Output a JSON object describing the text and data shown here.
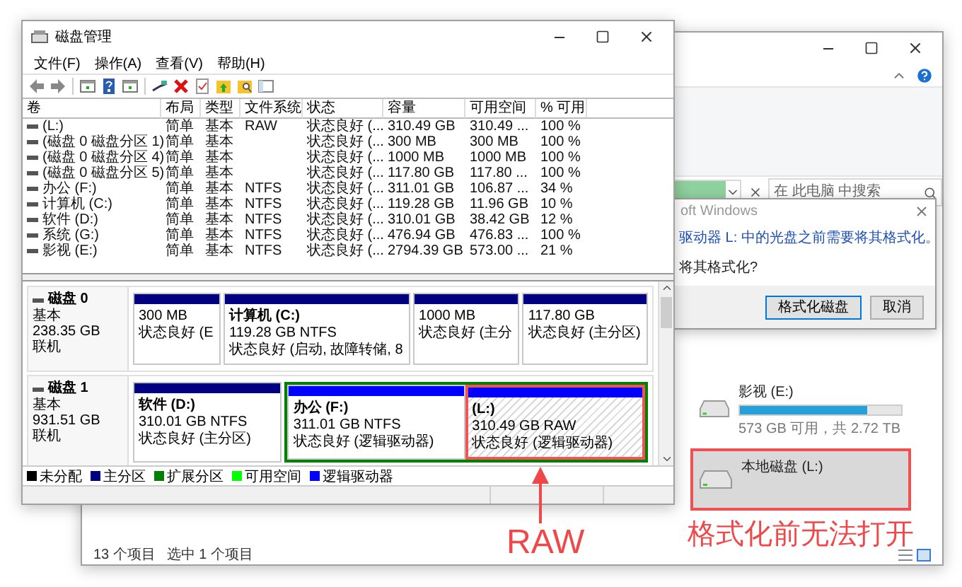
{
  "disk_management": {
    "title": "磁盘管理",
    "menu": [
      "文件(F)",
      "操作(A)",
      "查看(V)",
      "帮助(H)"
    ],
    "columns": [
      "卷",
      "布局",
      "类型",
      "文件系统",
      "状态",
      "容量",
      "可用空间",
      "% 可用"
    ],
    "volumes": [
      {
        "name": "(L:)",
        "layout": "简单",
        "type": "基本",
        "fs": "RAW",
        "status": "状态良好 (...",
        "capacity": "310.49 GB",
        "free": "310.49 ...",
        "pct": "100 %"
      },
      {
        "name": "(磁盘 0 磁盘分区 1)",
        "layout": "简单",
        "type": "基本",
        "status": "状态良好 (...",
        "capacity": "300 MB",
        "free": "300 MB",
        "pct": "100 %"
      },
      {
        "name": "(磁盘 0 磁盘分区 4)",
        "layout": "简单",
        "type": "基本",
        "status": "状态良好 (...",
        "capacity": "1000 MB",
        "free": "1000 MB",
        "pct": "100 %"
      },
      {
        "name": "(磁盘 0 磁盘分区 5)",
        "layout": "简单",
        "type": "基本",
        "status": "状态良好 (...",
        "capacity": "117.80 GB",
        "free": "117.80 ...",
        "pct": "100 %"
      },
      {
        "name": "办公 (F:)",
        "layout": "简单",
        "type": "基本",
        "fs": "NTFS",
        "status": "状态良好 (...",
        "capacity": "311.01 GB",
        "free": "106.87 ...",
        "pct": "34 %"
      },
      {
        "name": "计算机 (C:)",
        "layout": "简单",
        "type": "基本",
        "fs": "NTFS",
        "status": "状态良好 (...",
        "capacity": "119.28 GB",
        "free": "11.96 GB",
        "pct": "10 %"
      },
      {
        "name": "软件 (D:)",
        "layout": "简单",
        "type": "基本",
        "fs": "NTFS",
        "status": "状态良好 (...",
        "capacity": "310.01 GB",
        "free": "38.42 GB",
        "pct": "12 %"
      },
      {
        "name": "系统 (G:)",
        "layout": "简单",
        "type": "基本",
        "fs": "NTFS",
        "status": "状态良好 (...",
        "capacity": "476.94 GB",
        "free": "476.83 ...",
        "pct": "100 %"
      },
      {
        "name": "影视 (E:)",
        "layout": "简单",
        "type": "基本",
        "fs": "NTFS",
        "status": "状态良好 (...",
        "capacity": "2794.39 GB",
        "free": "573.00 ...",
        "pct": "21 %"
      }
    ],
    "disks": [
      {
        "name": "磁盘 0",
        "type": "基本",
        "size": "238.35 GB",
        "state": "联机",
        "partitions": [
          {
            "kind": "partition",
            "size": "300 MB",
            "status": "状态良好 (E",
            "color": "#000080",
            "selected": false,
            "highlighted": false
          },
          {
            "kind": "partition",
            "label": "计算机 (C:)",
            "size": "119.28 GB NTFS",
            "status": "状态良好 (启动, 故障转储, 8",
            "color": "#000080",
            "selected": false,
            "highlighted": false
          },
          {
            "kind": "partition",
            "size": "1000 MB",
            "status": "状态良好 (主分",
            "color": "#000080",
            "selected": false,
            "highlighted": false
          },
          {
            "kind": "partition",
            "size": "117.80 GB",
            "status": "状态良好 (主分区)",
            "color": "#000080",
            "selected": false,
            "highlighted": false
          }
        ]
      },
      {
        "name": "磁盘 1",
        "type": "基本",
        "size": "931.51 GB",
        "state": "联机",
        "partitions": [
          {
            "kind": "partition",
            "label": "软件 (D:)",
            "size": "310.01 GB NTFS",
            "status": "状态良好 (主分区)",
            "color": "#000080",
            "selected": false,
            "highlighted": false
          },
          {
            "kind": "extended",
            "color": "#008000",
            "children": [
              {
                "kind": "partition",
                "label": "办公 (F:)",
                "size": "311.01 GB NTFS",
                "status": "状态良好 (逻辑驱动器)",
                "color": "#0000ff",
                "selected": false,
                "highlighted": false
              },
              {
                "kind": "partition",
                "label": "(L:)",
                "size": "310.49 GB RAW",
                "status": "状态良好 (逻辑驱动器)",
                "color": "#0000ff",
                "selected": true,
                "highlighted": true
              }
            ]
          }
        ]
      }
    ],
    "legend": [
      {
        "label": "未分配",
        "color": "#000000"
      },
      {
        "label": "主分区",
        "color": "#000080"
      },
      {
        "label": "扩展分区",
        "color": "#008000"
      },
      {
        "label": "可用空间",
        "color": "#00ff00"
      },
      {
        "label": "逻辑驱动器",
        "color": "#0000ff"
      }
    ]
  },
  "explorer": {
    "search": {
      "placeholder": "在 此电脑 中搜索"
    },
    "drives": [
      {
        "name": "影视 (E:)",
        "level": 0.79,
        "free_text": "573 GB 可用，共 2.72 TB",
        "selected": false,
        "highlighted": false
      },
      {
        "name": "本地磁盘 (L:)",
        "selected": true,
        "highlighted": true
      }
    ],
    "status": [
      "13 个项目",
      "选中 1 个项目"
    ]
  },
  "dialog": {
    "title": "oft Windows",
    "message": "驱动器 L: 中的光盘之前需要将其格式化。",
    "question": "将其格式化?",
    "buttons": [
      {
        "label": "格式化磁盘",
        "selected": true
      },
      {
        "label": "取消",
        "selected": false
      }
    ]
  },
  "annotations": [
    {
      "kind": "arrow",
      "text": "RAW"
    },
    {
      "kind": "caption",
      "text": "格式化前无法打开"
    }
  ]
}
